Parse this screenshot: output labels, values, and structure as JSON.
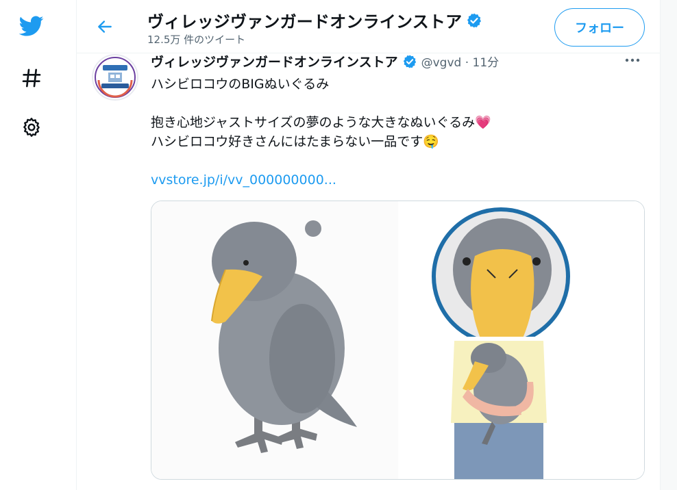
{
  "colors": {
    "accent": "#1d9bf0",
    "verified": "#1d9bf0",
    "secondary_text": "#536471"
  },
  "rail": {
    "items": [
      {
        "icon": "twitter-bird-icon"
      },
      {
        "icon": "hashtag-icon"
      },
      {
        "icon": "gear-icon"
      }
    ]
  },
  "header": {
    "back_icon": "back-arrow-icon",
    "title": "ヴィレッジヴァンガードオンラインストア",
    "tweet_count": "12.5万 件のツイート",
    "follow_label": "フォロー"
  },
  "tweet": {
    "name": "ヴィレッジヴァンガードオンラインストア",
    "handle_time": "@vgvd · 11分",
    "lines": [
      "ハシビロコウのBIGぬいぐるみ",
      "",
      "抱き心地ジャストサイズの夢のような大きなぬいぐるみ💗",
      "ハシビロコウ好きさんにはたまらない一品です🤤",
      ""
    ],
    "link": "vvstore.jp/i/vv_000000000...",
    "media": [
      {
        "alt": "shoebill-plush-full"
      },
      {
        "alt": "shoebill-plush-face-closeup"
      },
      {
        "alt": "person-holding-shoebill-plush"
      }
    ]
  }
}
